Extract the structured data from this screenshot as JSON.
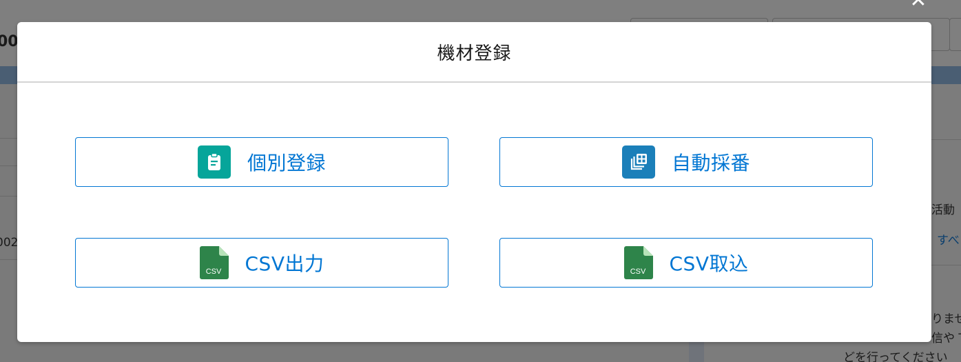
{
  "background": {
    "left_text_1": "00",
    "left_text_2": "002",
    "right_text_1": "活動",
    "right_text_2": "すべ",
    "right_text_3": "りませ",
    "right_text_4": "信や T",
    "right_text_5": "どを行ってください"
  },
  "modal": {
    "title": "機材登録",
    "close_glyph": "✕",
    "buttons": [
      {
        "label": "個別登録",
        "icon": "clipboard-icon",
        "icon_color": "#06a59a"
      },
      {
        "label": "自動採番",
        "icon": "stacked-grid-icon",
        "icon_color": "#1b7fb9"
      },
      {
        "label": "CSV出力",
        "icon": "csv-file-icon",
        "icon_color": "#2e844a",
        "icon_text": "CSV"
      },
      {
        "label": "CSV取込",
        "icon": "csv-file-icon",
        "icon_color": "#2e844a",
        "icon_text": "CSV"
      }
    ]
  },
  "colors": {
    "accent": "#0176d3",
    "overlay": "#7f7f7f"
  }
}
